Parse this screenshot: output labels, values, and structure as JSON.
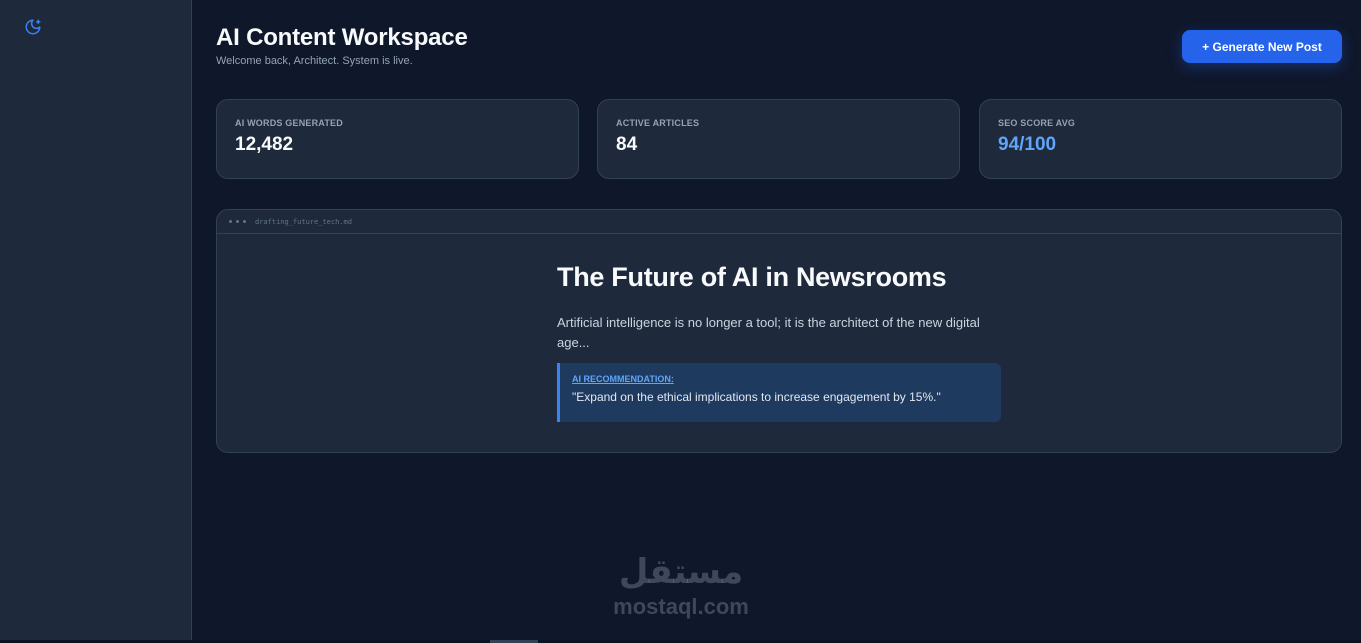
{
  "sidebar": {
    "theme_toggle_icon": "moon-star-icon",
    "accent": "#3b82f6"
  },
  "header": {
    "title": "AI Content Workspace",
    "subtitle": "Welcome back, Architect. System is live.",
    "primary_button": "+ Generate New Post"
  },
  "stats": [
    {
      "label": "AI WORDS GENERATED",
      "value": "12,482"
    },
    {
      "label": "ACTIVE ARTICLES",
      "value": "84"
    },
    {
      "label": "SEO SCORE AVG",
      "value": "94/100"
    }
  ],
  "editor": {
    "filename": "drafting_future_tech.md",
    "title": "The Future of AI in Newsrooms",
    "paragraph": "Artificial intelligence is no longer a tool; it is the architect of the new digital age...",
    "recommendation": {
      "label": "AI RECOMMENDATION:",
      "text": "\"Expand on the ethical implications to increase engagement by 15%.\""
    }
  },
  "watermark": {
    "arabic": "مستقل",
    "latin": "mostaql.com"
  },
  "colors": {
    "background": "#0f172a",
    "panel": "#1e293b",
    "primary": "#2563eb",
    "accent_text": "#60a5fa"
  }
}
